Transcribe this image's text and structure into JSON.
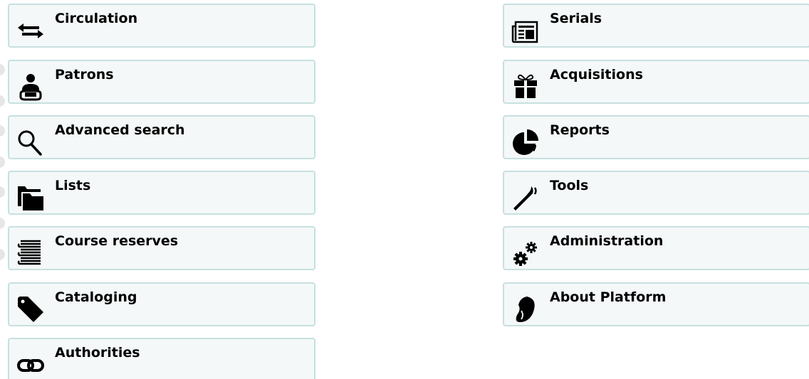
{
  "modules_left": [
    {
      "label": "Circulation",
      "icon": "circulation-arrows-icon"
    },
    {
      "label": "Patrons",
      "icon": "patron-person-icon"
    },
    {
      "label": "Advanced search",
      "icon": "magnifier-search-icon"
    },
    {
      "label": "Lists",
      "icon": "folders-icon"
    },
    {
      "label": "Course reserves",
      "icon": "stacked-books-icon"
    },
    {
      "label": "Cataloging",
      "icon": "tag-icon"
    },
    {
      "label": "Authorities",
      "icon": "chain-link-icon"
    }
  ],
  "modules_right": [
    {
      "label": "Serials",
      "icon": "newspaper-icon"
    },
    {
      "label": "Acquisitions",
      "icon": "gift-icon"
    },
    {
      "label": "Reports",
      "icon": "pie-chart-icon"
    },
    {
      "label": "Tools",
      "icon": "wrench-icon"
    },
    {
      "label": "Administration",
      "icon": "gears-icon"
    },
    {
      "label": "About Platform",
      "icon": "leaf-logo-icon"
    }
  ],
  "colors": {
    "button_bg": "#f4f8f9",
    "button_border": "#c7e0df",
    "text": "#000000",
    "icon": "#000000"
  }
}
